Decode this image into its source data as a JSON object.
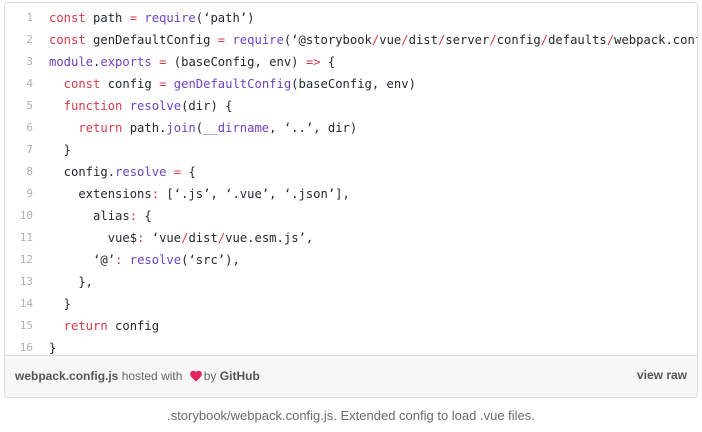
{
  "code": {
    "lines": [
      {
        "n": "1",
        "tokens": [
          {
            "t": "const ",
            "c": "k"
          },
          {
            "t": "path ",
            "c": "s"
          },
          {
            "t": "= ",
            "c": "k"
          },
          {
            "t": "require",
            "c": "f"
          },
          {
            "t": "(‘path’)",
            "c": "s"
          }
        ]
      },
      {
        "n": "2",
        "tokens": [
          {
            "t": "const ",
            "c": "k"
          },
          {
            "t": "genDefaultConfig ",
            "c": "s"
          },
          {
            "t": "= ",
            "c": "k"
          },
          {
            "t": "require",
            "c": "f"
          },
          {
            "t": "(‘@storybook",
            "c": "s"
          },
          {
            "t": "/",
            "c": "k"
          },
          {
            "t": "vue",
            "c": "s"
          },
          {
            "t": "/",
            "c": "k"
          },
          {
            "t": "dist",
            "c": "s"
          },
          {
            "t": "/",
            "c": "k"
          },
          {
            "t": "server",
            "c": "s"
          },
          {
            "t": "/",
            "c": "k"
          },
          {
            "t": "config",
            "c": "s"
          },
          {
            "t": "/",
            "c": "k"
          },
          {
            "t": "defaults",
            "c": "s"
          },
          {
            "t": "/",
            "c": "k"
          },
          {
            "t": "webpack.config",
            "c": "s"
          }
        ]
      },
      {
        "n": "3",
        "tokens": [
          {
            "t": "module",
            "c": "f"
          },
          {
            "t": ".",
            "c": "s"
          },
          {
            "t": "exports ",
            "c": "f"
          },
          {
            "t": "= ",
            "c": "k"
          },
          {
            "t": "(baseConfig, env) ",
            "c": "s"
          },
          {
            "t": "=> ",
            "c": "k"
          },
          {
            "t": "{",
            "c": "s"
          }
        ]
      },
      {
        "n": "4",
        "tokens": [
          {
            "t": "  const ",
            "c": "k"
          },
          {
            "t": "config ",
            "c": "s"
          },
          {
            "t": "= ",
            "c": "k"
          },
          {
            "t": "genDefaultConfig",
            "c": "f"
          },
          {
            "t": "(baseConfig, env)",
            "c": "s"
          }
        ]
      },
      {
        "n": "5",
        "tokens": [
          {
            "t": "  function ",
            "c": "k"
          },
          {
            "t": "resolve",
            "c": "f"
          },
          {
            "t": "(dir) {",
            "c": "s"
          }
        ]
      },
      {
        "n": "6",
        "tokens": [
          {
            "t": "    return ",
            "c": "k"
          },
          {
            "t": "path.",
            "c": "s"
          },
          {
            "t": "join",
            "c": "f"
          },
          {
            "t": "(",
            "c": "s"
          },
          {
            "t": "__dirname",
            "c": "f"
          },
          {
            "t": ", ‘..’, dir)",
            "c": "s"
          }
        ]
      },
      {
        "n": "7",
        "tokens": [
          {
            "t": "  }",
            "c": "s"
          }
        ]
      },
      {
        "n": "8",
        "tokens": [
          {
            "t": "  config.",
            "c": "s"
          },
          {
            "t": "resolve ",
            "c": "f"
          },
          {
            "t": "= ",
            "c": "k"
          },
          {
            "t": "{",
            "c": "s"
          }
        ]
      },
      {
        "n": "9",
        "tokens": [
          {
            "t": "    extensions",
            "c": "s"
          },
          {
            "t": ": ",
            "c": "k"
          },
          {
            "t": "[‘.js’, ‘.vue’, ‘.json’],",
            "c": "s"
          }
        ]
      },
      {
        "n": "10",
        "tokens": [
          {
            "t": "      alias",
            "c": "s"
          },
          {
            "t": ": ",
            "c": "k"
          },
          {
            "t": "{",
            "c": "s"
          }
        ]
      },
      {
        "n": "11",
        "tokens": [
          {
            "t": "        vue$",
            "c": "s"
          },
          {
            "t": ": ",
            "c": "k"
          },
          {
            "t": "‘vue",
            "c": "s"
          },
          {
            "t": "/",
            "c": "k"
          },
          {
            "t": "dist",
            "c": "s"
          },
          {
            "t": "/",
            "c": "k"
          },
          {
            "t": "vue.esm.js’,",
            "c": "s"
          }
        ]
      },
      {
        "n": "12",
        "tokens": [
          {
            "t": "      ‘@’",
            "c": "s"
          },
          {
            "t": ": ",
            "c": "k"
          },
          {
            "t": "resolve",
            "c": "f"
          },
          {
            "t": "(‘src’),",
            "c": "s"
          }
        ]
      },
      {
        "n": "13",
        "tokens": [
          {
            "t": "    },",
            "c": "s"
          }
        ]
      },
      {
        "n": "14",
        "tokens": [
          {
            "t": "  }",
            "c": "s"
          }
        ]
      },
      {
        "n": "15",
        "tokens": [
          {
            "t": "  return ",
            "c": "k"
          },
          {
            "t": "config",
            "c": "s"
          }
        ]
      },
      {
        "n": "16",
        "tokens": [
          {
            "t": "}",
            "c": "s"
          }
        ]
      }
    ]
  },
  "meta": {
    "filename": "webpack.config.js",
    "hosted_with": "hosted with",
    "by": "by",
    "github": "GitHub",
    "view_raw": "view raw",
    "heart_icon": "heart-icon"
  },
  "caption": ".storybook/webpack.config.js. Extended config to load .vue files.",
  "colors": {
    "keyword": "#d73a49",
    "function": "#6f42c1",
    "text": "#24292e",
    "heart": "#e0245e"
  }
}
